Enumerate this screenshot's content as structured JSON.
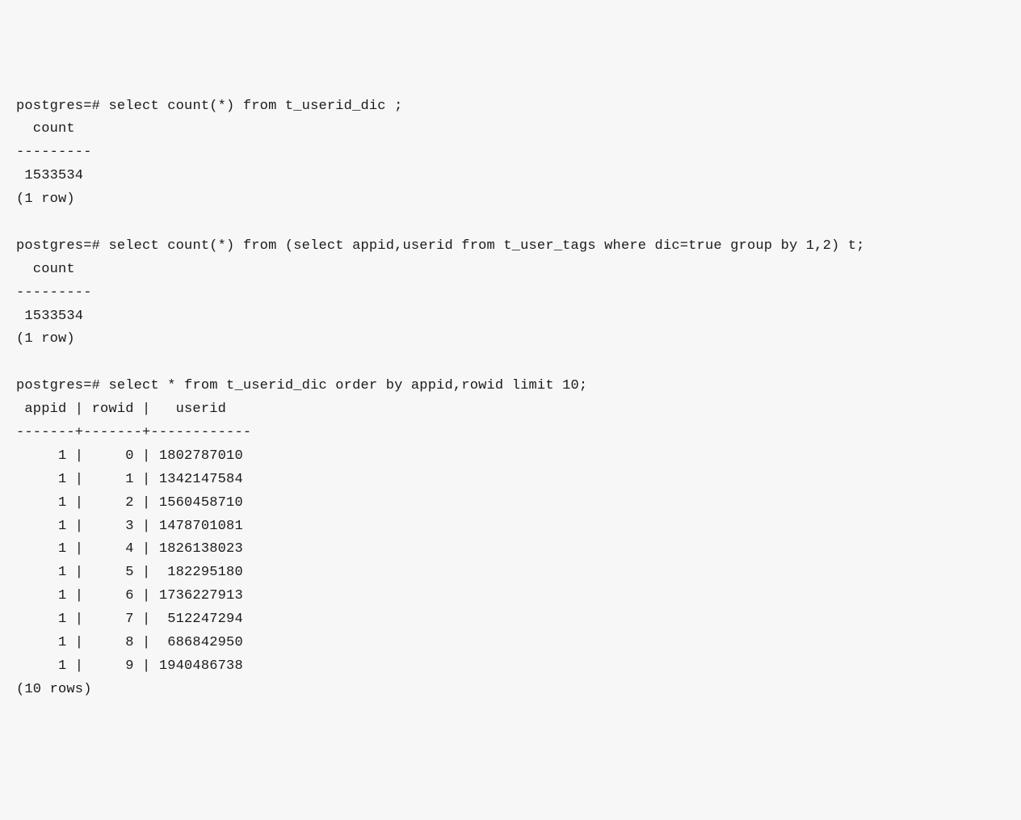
{
  "prompt": "postgres=#",
  "queries": {
    "q1": {
      "sql": "select count(*) from t_userid_dic ;",
      "header": "  count  ",
      "separator": "---------",
      "result": " 1533534",
      "footer": "(1 row)"
    },
    "q2": {
      "sql": "select count(*) from (select appid,userid from t_user_tags where dic=true group by 1,2) t;",
      "header": "  count  ",
      "separator": "---------",
      "result": " 1533534",
      "footer": "(1 row)"
    },
    "q3": {
      "sql": "select * from t_userid_dic order by appid,rowid limit 10;",
      "header": " appid | rowid |   userid   ",
      "separator": "-------+-------+------------",
      "rows": [
        "     1 |     0 | 1802787010",
        "     1 |     1 | 1342147584",
        "     1 |     2 | 1560458710",
        "     1 |     3 | 1478701081",
        "     1 |     4 | 1826138023",
        "     1 |     5 |  182295180",
        "     1 |     6 | 1736227913",
        "     1 |     7 |  512247294",
        "     1 |     8 |  686842950",
        "     1 |     9 | 1940486738"
      ],
      "footer": "(10 rows)"
    }
  },
  "chart_data": {
    "type": "table",
    "title": "t_userid_dic query results",
    "columns": [
      "appid",
      "rowid",
      "userid"
    ],
    "rows": [
      [
        1,
        0,
        1802787010
      ],
      [
        1,
        1,
        1342147584
      ],
      [
        1,
        2,
        1560458710
      ],
      [
        1,
        3,
        1478701081
      ],
      [
        1,
        4,
        1826138023
      ],
      [
        1,
        5,
        182295180
      ],
      [
        1,
        6,
        1736227913
      ],
      [
        1,
        7,
        512247294
      ],
      [
        1,
        8,
        686842950
      ],
      [
        1,
        9,
        1940486738
      ]
    ],
    "count_results": [
      {
        "query": "t_userid_dic",
        "count": 1533534
      },
      {
        "query": "t_user_tags distinct appid,userid where dic=true",
        "count": 1533534
      }
    ]
  }
}
